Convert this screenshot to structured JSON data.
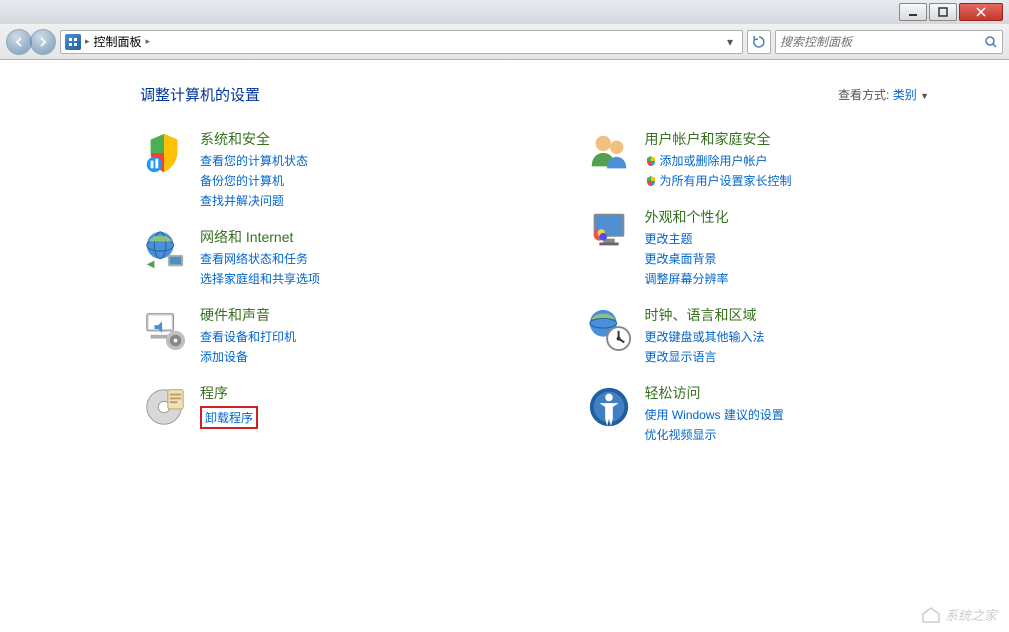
{
  "window": {
    "minimize_tooltip": "最小化",
    "maximize_tooltip": "最大化",
    "close_tooltip": "关闭"
  },
  "nav": {
    "breadcrumb_text": "控制面板",
    "search_placeholder": "搜索控制面板"
  },
  "header": {
    "title": "调整计算机的设置",
    "view_by_label": "查看方式:",
    "view_by_value": "类别"
  },
  "left_categories": [
    {
      "id": "system-security",
      "title": "系统和安全",
      "links": [
        {
          "text": "查看您的计算机状态",
          "shield": false
        },
        {
          "text": "备份您的计算机",
          "shield": false
        },
        {
          "text": "查找并解决问题",
          "shield": false
        }
      ]
    },
    {
      "id": "network-internet",
      "title": "网络和 Internet",
      "links": [
        {
          "text": "查看网络状态和任务",
          "shield": false
        },
        {
          "text": "选择家庭组和共享选项",
          "shield": false
        }
      ]
    },
    {
      "id": "hardware-sound",
      "title": "硬件和声音",
      "links": [
        {
          "text": "查看设备和打印机",
          "shield": false
        },
        {
          "text": "添加设备",
          "shield": false
        }
      ]
    },
    {
      "id": "programs",
      "title": "程序",
      "links": [
        {
          "text": "卸载程序",
          "shield": false,
          "highlighted": true
        }
      ]
    }
  ],
  "right_categories": [
    {
      "id": "user-accounts",
      "title": "用户帐户和家庭安全",
      "links": [
        {
          "text": "添加或删除用户帐户",
          "shield": true
        },
        {
          "text": "为所有用户设置家长控制",
          "shield": true
        }
      ]
    },
    {
      "id": "appearance",
      "title": "外观和个性化",
      "links": [
        {
          "text": "更改主题",
          "shield": false
        },
        {
          "text": "更改桌面背景",
          "shield": false
        },
        {
          "text": "调整屏幕分辨率",
          "shield": false
        }
      ]
    },
    {
      "id": "clock-region",
      "title": "时钟、语言和区域",
      "links": [
        {
          "text": "更改键盘或其他输入法",
          "shield": false
        },
        {
          "text": "更改显示语言",
          "shield": false
        }
      ]
    },
    {
      "id": "ease-of-access",
      "title": "轻松访问",
      "links": [
        {
          "text": "使用 Windows 建议的设置",
          "shield": false
        },
        {
          "text": "优化视频显示",
          "shield": false
        }
      ]
    }
  ],
  "watermark": "系统之家"
}
